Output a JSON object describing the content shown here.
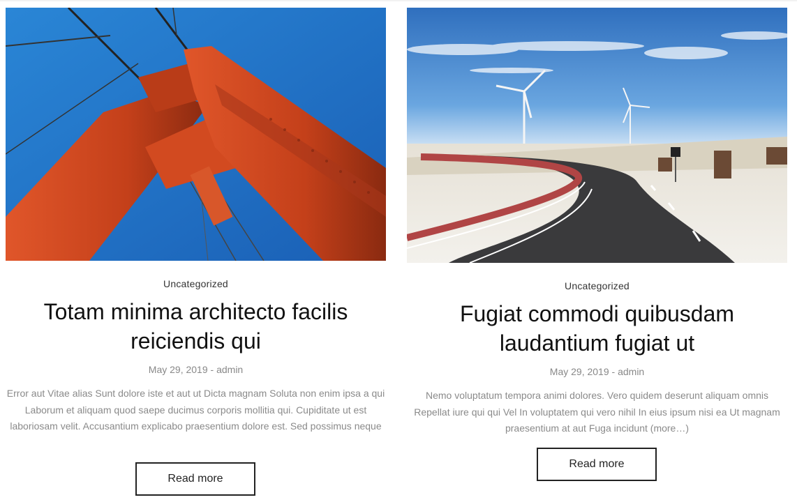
{
  "posts": [
    {
      "category": "Uncategorized",
      "title": "Totam minima architecto facilis reiciendis qui",
      "date": "May 29, 2019",
      "author": "admin",
      "meta_separator": " - ",
      "excerpt": "Error aut Vitae alias Sunt dolore iste et aut ut Dicta magnam Soluta non enim ipsa a qui Laborum et aliquam quod saepe ducimus corporis mollitia qui. Cupiditate ut est laboriosam velit. Accusantium explicabo praesentium dolore est. Sed possimus neque",
      "read_more": "Read more"
    },
    {
      "category": "Uncategorized",
      "title": "Fugiat commodi quibusdam laudantium fugiat ut",
      "date": "May 29, 2019",
      "author": "admin",
      "meta_separator": " - ",
      "excerpt": "Nemo voluptatum tempora animi dolores. Vero quidem deserunt aliquam omnis Repellat iure qui qui Vel In voluptatem qui vero nihil In eius ipsum nisi ea Ut magnam praesentium at aut Fuga incidunt (more…)",
      "read_more": "Read more"
    }
  ],
  "colors": {
    "title": "#111111",
    "meta": "#888888",
    "excerpt": "#8a8a8a",
    "button_border": "#222222",
    "bridge_orange": "#c8461e",
    "sky_blue": "#1f7fd0"
  }
}
